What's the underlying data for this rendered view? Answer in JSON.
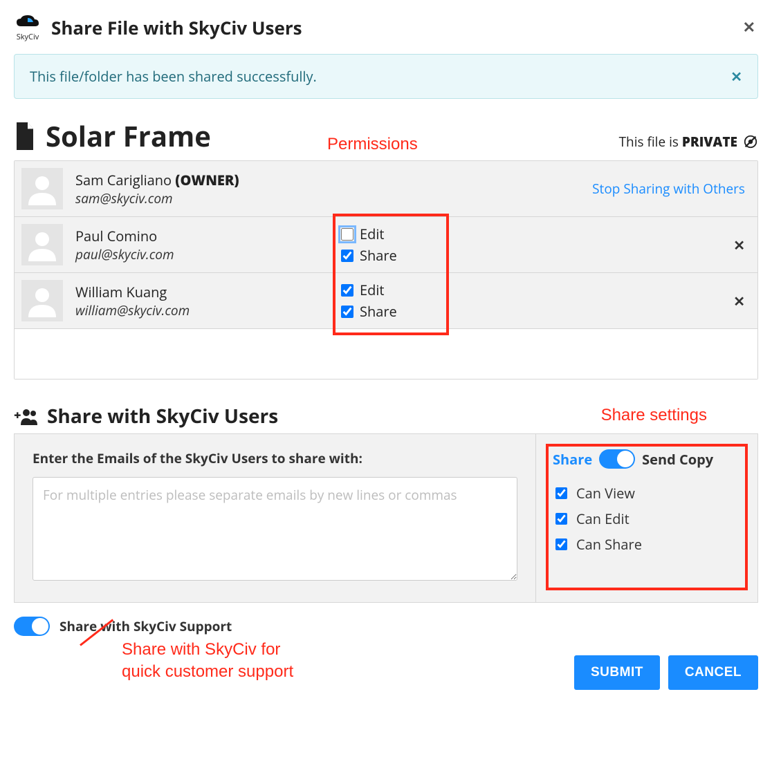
{
  "brand": "SkyCiv",
  "modal_title": "Share File with SkyCiv Users",
  "alert_text": "This file/folder has been shared successfully.",
  "file_name": "Solar Frame",
  "privacy_prefix": "This file is ",
  "privacy_state": "PRIVATE",
  "stop_sharing_label": "Stop Sharing with Others",
  "perm_edit_label": "Edit",
  "perm_share_label": "Share",
  "users": [
    {
      "name": "Sam Carigliano",
      "owner_tag": "(OWNER)",
      "email": "sam@skyciv.com",
      "is_owner": true
    },
    {
      "name": "Paul Comino",
      "email": "paul@skyciv.com",
      "edit": false,
      "share": true
    },
    {
      "name": "William Kuang",
      "email": "william@skyciv.com",
      "edit": true,
      "share": true
    }
  ],
  "share_section_title": "Share with SkyCiv Users",
  "emails_field_label": "Enter the Emails of the SkyCiv Users to share with:",
  "emails_placeholder": "For multiple entries please separate emails by new lines or commas",
  "toggle_share_label": "Share",
  "toggle_copy_label": "Send Copy",
  "options": {
    "can_view": {
      "label": "Can View",
      "checked": true
    },
    "can_edit": {
      "label": "Can Edit",
      "checked": true
    },
    "can_share": {
      "label": "Can Share",
      "checked": true
    }
  },
  "support_toggle_label": "Share with SkyCiv Support",
  "buttons": {
    "submit": "SUBMIT",
    "cancel": "CANCEL"
  },
  "annotations": {
    "permissions": "Permissions",
    "share_settings": "Share settings",
    "support_note_1": "Share with SkyCiv for",
    "support_note_2": "quick customer support"
  }
}
